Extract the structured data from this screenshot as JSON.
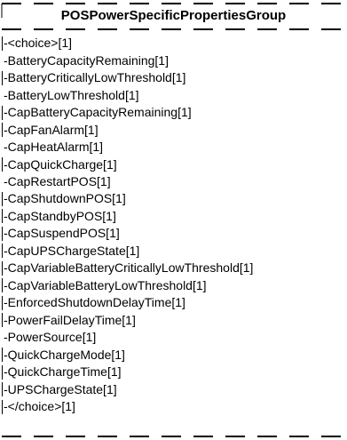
{
  "group": {
    "title": "POSPowerSpecificPropertiesGroup",
    "members": [
      {
        "label": "-<choice>[1]",
        "tick": true
      },
      {
        "label": "-BatteryCapacityRemaining[1]",
        "tick": false
      },
      {
        "label": "-BatteryCriticallyLowThreshold[1]",
        "tick": true
      },
      {
        "label": "-BatteryLowThreshold[1]",
        "tick": false
      },
      {
        "label": "-CapBatteryCapacityRemaining[1]",
        "tick": true
      },
      {
        "label": "-CapFanAlarm[1]",
        "tick": true
      },
      {
        "label": "-CapHeatAlarm[1]",
        "tick": false
      },
      {
        "label": "-CapQuickCharge[1]",
        "tick": true
      },
      {
        "label": "-CapRestartPOS[1]",
        "tick": false
      },
      {
        "label": "-CapShutdownPOS[1]",
        "tick": true
      },
      {
        "label": "-CapStandbyPOS[1]",
        "tick": true
      },
      {
        "label": "-CapSuspendPOS[1]",
        "tick": true
      },
      {
        "label": "-CapUPSChargeState[1]",
        "tick": true
      },
      {
        "label": "-CapVariableBatteryCriticallyLowThreshold[1]",
        "tick": true
      },
      {
        "label": "-CapVariableBatteryLowThreshold[1]",
        "tick": true
      },
      {
        "label": "-EnforcedShutdownDelayTime[1]",
        "tick": true
      },
      {
        "label": "-PowerFailDelayTime[1]",
        "tick": true
      },
      {
        "label": "-PowerSource[1]",
        "tick": false
      },
      {
        "label": "-QuickChargeMode[1]",
        "tick": true
      },
      {
        "label": "-QuickChargeTime[1]",
        "tick": true
      },
      {
        "label": "-UPSChargeState[1]",
        "tick": true
      },
      {
        "label": "-</choice>[1]",
        "tick": true
      }
    ]
  },
  "colors": {
    "line": "#000000",
    "background": "#ffffff"
  }
}
